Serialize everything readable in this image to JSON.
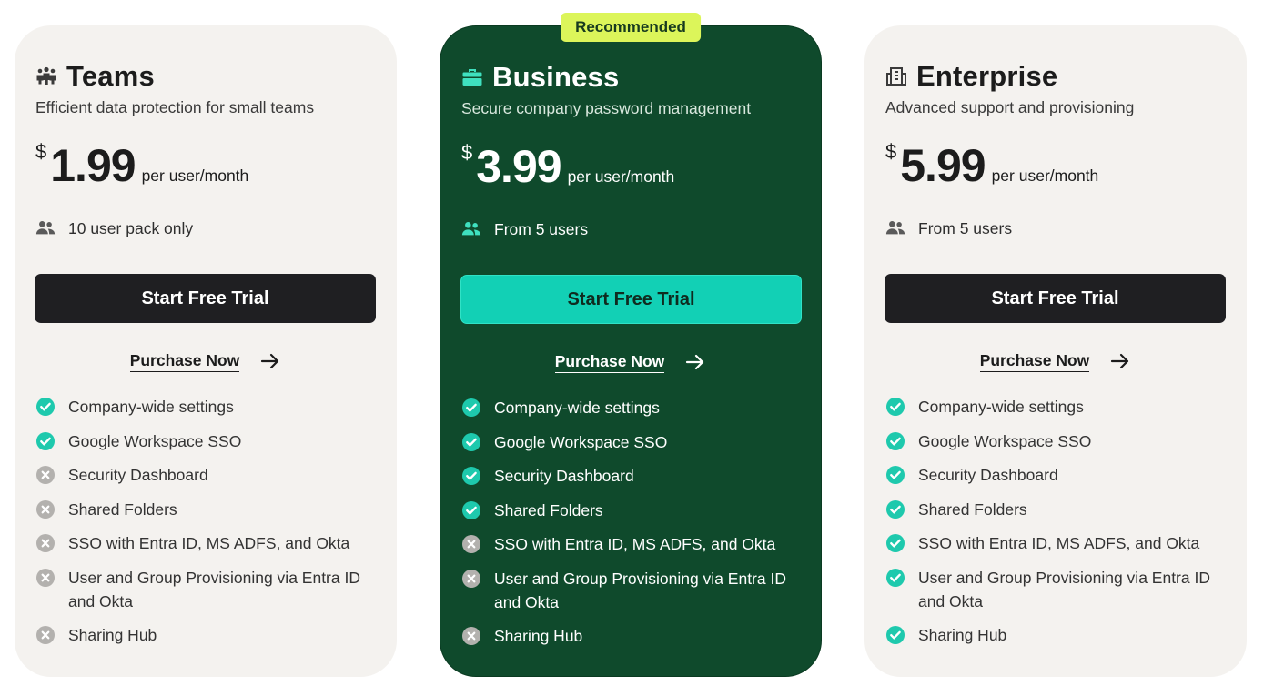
{
  "plans": [
    {
      "name": "Teams",
      "icon": "people-group-icon",
      "tagline": "Efficient data protection for small teams",
      "currency": "$",
      "price": "1.99",
      "per": "per user/month",
      "users": "10 user pack only",
      "trial_label": "Start Free Trial",
      "purchase_label": "Purchase Now",
      "features": [
        {
          "label": "Company-wide settings",
          "included": true
        },
        {
          "label": "Google Workspace SSO",
          "included": true
        },
        {
          "label": "Security Dashboard",
          "included": false
        },
        {
          "label": "Shared Folders",
          "included": false
        },
        {
          "label": "SSO with Entra ID, MS ADFS, and Okta",
          "included": false
        },
        {
          "label": "User and Group Provisioning via Entra ID and Okta",
          "included": false
        },
        {
          "label": "Sharing Hub",
          "included": false
        }
      ]
    },
    {
      "name": "Business",
      "icon": "briefcase-icon",
      "badge": "Recommended",
      "tagline": "Secure company password management",
      "currency": "$",
      "price": "3.99",
      "per": "per user/month",
      "users": "From 5 users",
      "trial_label": "Start Free Trial",
      "purchase_label": "Purchase Now",
      "features": [
        {
          "label": "Company-wide settings",
          "included": true
        },
        {
          "label": "Google Workspace SSO",
          "included": true
        },
        {
          "label": "Security Dashboard",
          "included": true
        },
        {
          "label": "Shared Folders",
          "included": true
        },
        {
          "label": "SSO with Entra ID, MS ADFS, and Okta",
          "included": false
        },
        {
          "label": "User and Group Provisioning via Entra ID and Okta",
          "included": false
        },
        {
          "label": "Sharing Hub",
          "included": false
        }
      ]
    },
    {
      "name": "Enterprise",
      "icon": "building-icon",
      "tagline": "Advanced support and provisioning",
      "currency": "$",
      "price": "5.99",
      "per": "per user/month",
      "users": "From 5 users",
      "trial_label": "Start Free Trial",
      "purchase_label": "Purchase Now",
      "features": [
        {
          "label": "Company-wide settings",
          "included": true
        },
        {
          "label": "Google Workspace SSO",
          "included": true
        },
        {
          "label": "Security Dashboard",
          "included": true
        },
        {
          "label": "Shared Folders",
          "included": true
        },
        {
          "label": "SSO with Entra ID, MS ADFS, and Okta",
          "included": true
        },
        {
          "label": "User and Group Provisioning via Entra ID and Okta",
          "included": true
        },
        {
          "label": "Sharing Hub",
          "included": true
        }
      ]
    }
  ],
  "colors": {
    "card_light": "#f4f2ef",
    "card_featured": "#0f4a2c",
    "badge": "#dcf55a",
    "accent_teal": "#12d0b5",
    "check_teal": "#1ec9ad",
    "cross_gray": "#b3b1ae",
    "button_dark": "#1f1f22"
  }
}
